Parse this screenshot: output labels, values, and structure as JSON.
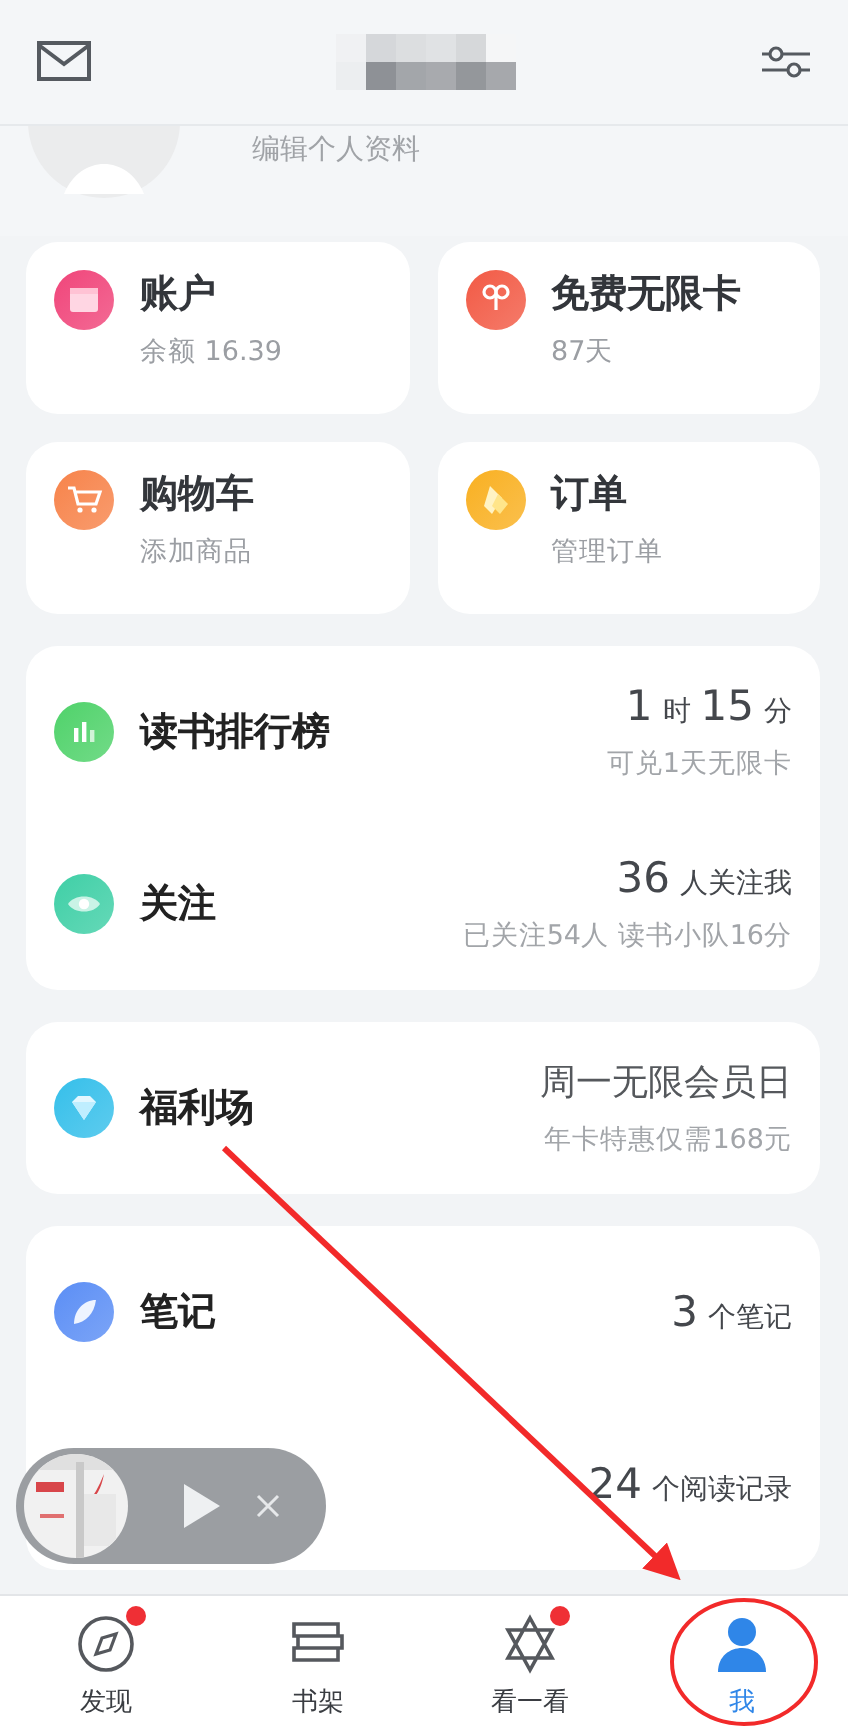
{
  "profile": {
    "edit_link": "编辑个人资料"
  },
  "tiles": [
    {
      "title": "账户",
      "subtitle": "余额 16.39",
      "color": "#f0457a"
    },
    {
      "title": "免费无限卡",
      "subtitle": "87天",
      "color": "#f25a45"
    },
    {
      "title": "购物车",
      "subtitle": "添加商品",
      "color": "#f7834a"
    },
    {
      "title": "订单",
      "subtitle": "管理订单",
      "color": "#f9b021"
    }
  ],
  "sections": [
    {
      "rows": [
        {
          "title": "读书排行榜",
          "color": "#4fd26a",
          "value": [
            {
              "kind": "number",
              "text": "1"
            },
            {
              "kind": "unit",
              "text": "时"
            },
            {
              "kind": "number",
              "text": "15"
            },
            {
              "kind": "unit",
              "text": "分"
            }
          ],
          "note": "可兑1天无限卡"
        },
        {
          "title": "关注",
          "color": "#3fcfa6",
          "value": [
            {
              "kind": "number",
              "text": "36"
            },
            {
              "kind": "unit",
              "text": "人关注我"
            }
          ],
          "note": "已关注54人 读书小队16分"
        }
      ]
    },
    {
      "rows": [
        {
          "title": "福利场",
          "color": "#35bfea",
          "value": [
            {
              "kind": "text",
              "text": "周一无限会员日"
            }
          ],
          "note": "年卡特惠仅需168元"
        }
      ]
    },
    {
      "rows": [
        {
          "title": "笔记",
          "color": "#5b8ef5",
          "value": [
            {
              "kind": "number",
              "text": "3"
            },
            {
              "kind": "unit",
              "text": "个笔记"
            }
          ]
        },
        {
          "value": [
            {
              "kind": "number",
              "text": "24"
            },
            {
              "kind": "unit",
              "text": "个阅读记录"
            }
          ]
        }
      ]
    }
  ],
  "tabs": [
    {
      "label": "发现",
      "selected": false,
      "badge": true
    },
    {
      "label": "书架",
      "selected": false,
      "badge": false
    },
    {
      "label": "看一看",
      "selected": false,
      "badge": true
    },
    {
      "label": "我",
      "selected": true,
      "badge": false
    }
  ]
}
